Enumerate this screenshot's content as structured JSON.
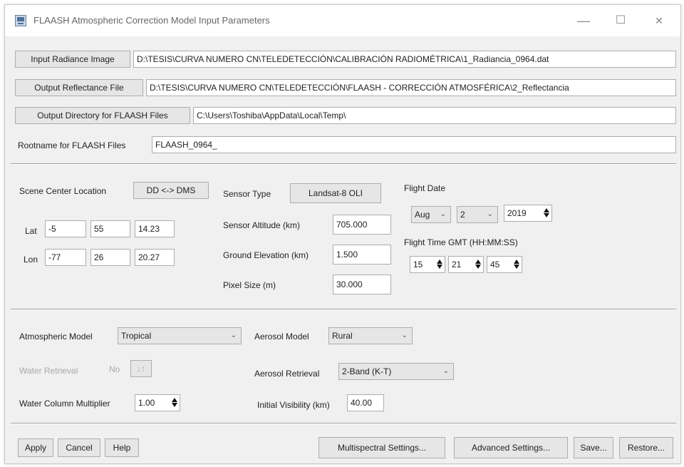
{
  "window": {
    "title": "FLAASH Atmospheric Correction Model Input Parameters",
    "minimize": "—",
    "maximize": "☐",
    "close": "✕"
  },
  "files": {
    "input_radiance_button": "Input Radiance Image",
    "input_radiance_value": "D:\\TESIS\\CURVA NUMERO CN\\TELEDETECCIÓN\\CALIBRACIÓN RADIOMÉTRICA\\1_Radiancia_0964.dat",
    "output_reflectance_button": "Output Reflectance File",
    "output_reflectance_value": "D:\\TESIS\\CURVA NUMERO CN\\TELEDETECCIÓN\\FLAASH - CORRECCIÓN ATMOSFÉRICA\\2_Reflectancia",
    "output_directory_button": "Output Directory for FLAASH Files",
    "output_directory_value": "C:\\Users\\Toshiba\\AppData\\Local\\Temp\\",
    "rootname_label": "Rootname for FLAASH Files",
    "rootname_value": "FLAASH_0964_"
  },
  "scene": {
    "center_label": "Scene Center Location",
    "dd_dms_button": "DD <-> DMS",
    "lat_label": "Lat",
    "lat": [
      "-5",
      "55",
      "14.23"
    ],
    "lon_label": "Lon",
    "lon": [
      "-77",
      "26",
      "20.27"
    ]
  },
  "sensor": {
    "type_label": "Sensor Type",
    "type_value": "Landsat-8 OLI",
    "altitude_label": "Sensor Altitude (km)",
    "altitude_value": "705.000",
    "elevation_label": "Ground Elevation (km)",
    "elevation_value": "1.500",
    "pixel_label": "Pixel Size (m)",
    "pixel_value": "30.000"
  },
  "flight": {
    "date_label": "Flight Date",
    "month": "Aug",
    "day": "2",
    "year": "2019",
    "time_label": "Flight Time GMT (HH:MM:SS)",
    "hh": "15",
    "mm": "21",
    "ss": "45"
  },
  "atmos": {
    "model_label": "Atmospheric Model",
    "model_value": "Tropical",
    "water_retrieval_label": "Water Retrieval",
    "water_retrieval_value": "No",
    "toggle_label": "↓↑",
    "water_column_label": "Water Column Multiplier",
    "water_column_value": "1.00",
    "aerosol_model_label": "Aerosol Model",
    "aerosol_model_value": "Rural",
    "aerosol_retrieval_label": "Aerosol Retrieval",
    "aerosol_retrieval_value": "2-Band (K-T)",
    "visibility_label": "Initial Visibility (km)",
    "visibility_value": "40.00"
  },
  "footer": {
    "apply": "Apply",
    "cancel": "Cancel",
    "help": "Help",
    "multispectral": "Multispectral Settings...",
    "advanced": "Advanced Settings...",
    "save": "Save...",
    "restore": "Restore..."
  }
}
